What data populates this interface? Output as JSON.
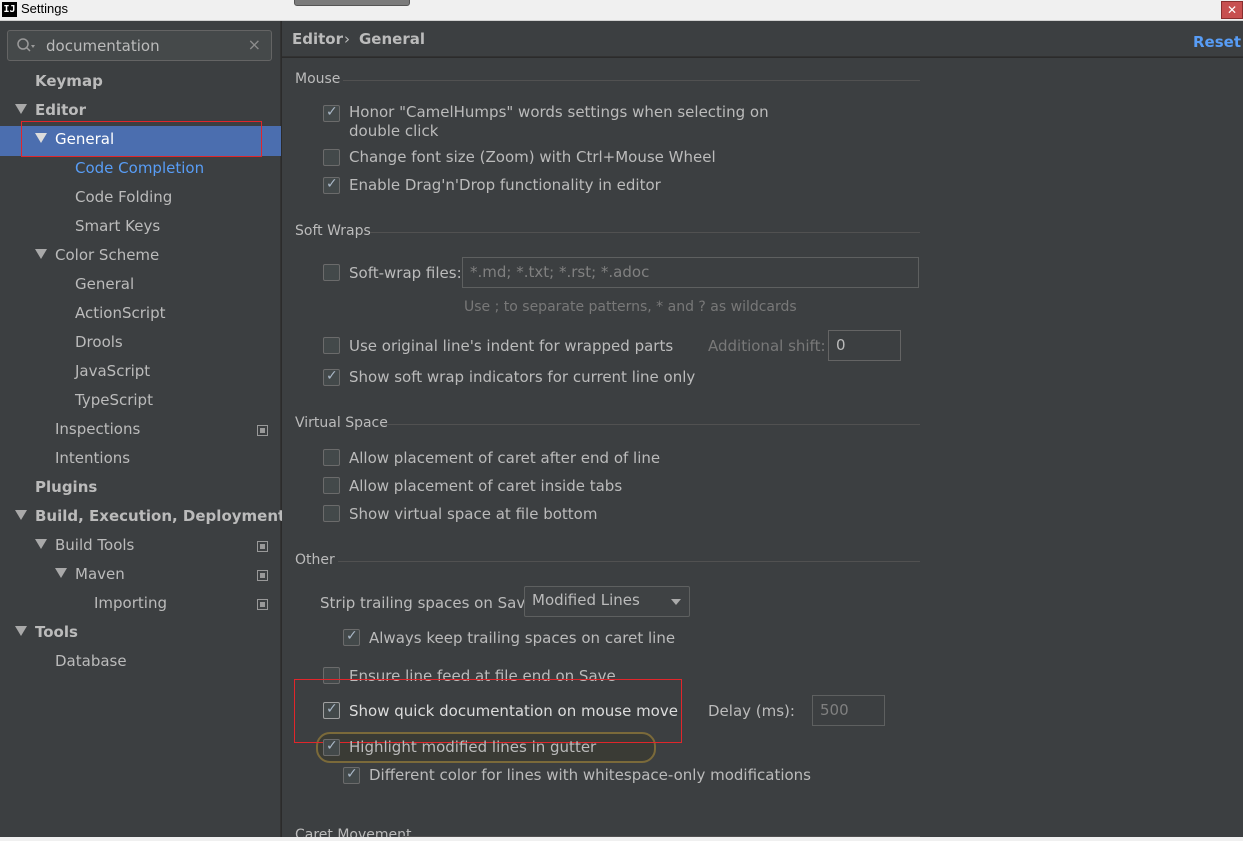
{
  "window": {
    "app_icon": "IJ",
    "title": "Settings",
    "close": "✕"
  },
  "search": {
    "value": "documentation",
    "clear": "×"
  },
  "tree": [
    {
      "label": "Keymap"
    },
    {
      "label": "Editor"
    },
    {
      "label": "General"
    },
    {
      "label": "Code Completion"
    },
    {
      "label": "Code Folding"
    },
    {
      "label": "Smart Keys"
    },
    {
      "label": "Color Scheme"
    },
    {
      "label": "General"
    },
    {
      "label": "ActionScript"
    },
    {
      "label": "Drools"
    },
    {
      "label": "JavaScript"
    },
    {
      "label": "TypeScript"
    },
    {
      "label": "Inspections"
    },
    {
      "label": "Intentions"
    },
    {
      "label": "Plugins"
    },
    {
      "label": "Build, Execution, Deployment"
    },
    {
      "label": "Build Tools"
    },
    {
      "label": "Maven"
    },
    {
      "label": "Importing"
    },
    {
      "label": "Tools"
    },
    {
      "label": "Database"
    }
  ],
  "breadcrumb": {
    "part1": "Editor",
    "separator": "›",
    "part2": "General",
    "reset": "Reset"
  },
  "mouse": {
    "title": "Mouse",
    "camel_line1": "Honor \"CamelHumps\" words settings when selecting on",
    "camel_line2": "double click",
    "zoom": "Change font size (Zoom) with Ctrl+Mouse Wheel",
    "dnd": "Enable Drag'n'Drop functionality in editor"
  },
  "soft_wraps": {
    "title": "Soft Wraps",
    "files_label": "Soft-wrap files:",
    "files_value": "*.md; *.txt; *.rst; *.adoc",
    "hint": "Use ; to separate patterns, * and ? as wildcards",
    "indent": "Use original line's indent for wrapped parts",
    "shift_label": "Additional shift:",
    "shift_value": "0",
    "indicators": "Show soft wrap indicators for current line only"
  },
  "virtual_space": {
    "title": "Virtual Space",
    "after_eol": "Allow placement of caret after end of line",
    "inside_tabs": "Allow placement of caret inside tabs",
    "file_bottom": "Show virtual space at file bottom"
  },
  "other": {
    "title": "Other",
    "strip_label": "Strip trailing spaces on Save:",
    "strip_value": "Modified Lines",
    "keep_trailing": "Always keep trailing spaces on caret line",
    "line_feed": "Ensure line feed at file end on Save",
    "quick_doc": "Show quick documentation on mouse move",
    "delay_label": "Delay (ms):",
    "delay_value": "500",
    "highlight": "Highlight modified lines in gutter",
    "whitespace": "Different color for lines with whitespace-only modifications"
  },
  "caret_movement": {
    "title": "Caret Movement"
  },
  "colors": {
    "selection": "#4b6eaf",
    "link": "#589df6",
    "highlight_box": "#e0262b"
  }
}
